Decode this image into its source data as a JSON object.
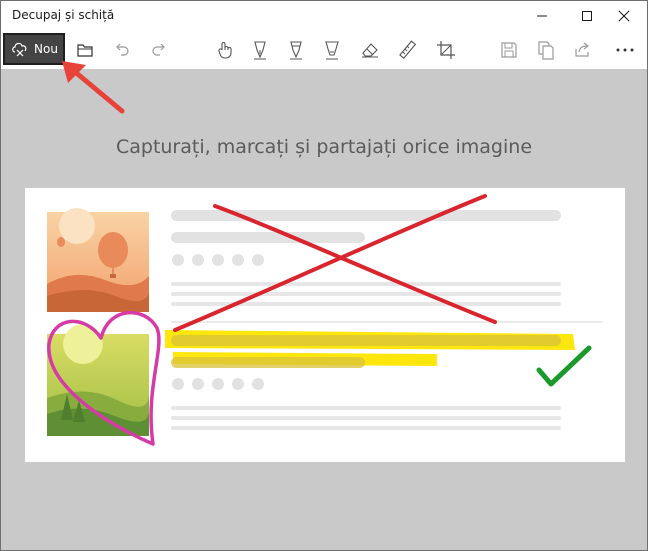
{
  "window": {
    "title": "Decupaj și schiță"
  },
  "toolbar": {
    "new_label": "Nou",
    "buttons": [
      "open-folder-icon",
      "undo-icon",
      "redo-icon",
      "touch-writing-icon",
      "ballpoint-pen-icon",
      "pencil-icon",
      "highlighter-icon",
      "eraser-icon",
      "ruler-icon",
      "crop-icon",
      "save-icon",
      "copy-icon",
      "share-icon",
      "more-icon"
    ]
  },
  "main": {
    "heading": "Capturați, marcați și partajați orice imagine"
  },
  "colors": {
    "accent_arrow": "#e8433a",
    "markup_red": "#d9252e",
    "highlight_yellow": "#ffe500",
    "heart_pink": "#d63aa6",
    "check_green": "#1a9a2a"
  }
}
